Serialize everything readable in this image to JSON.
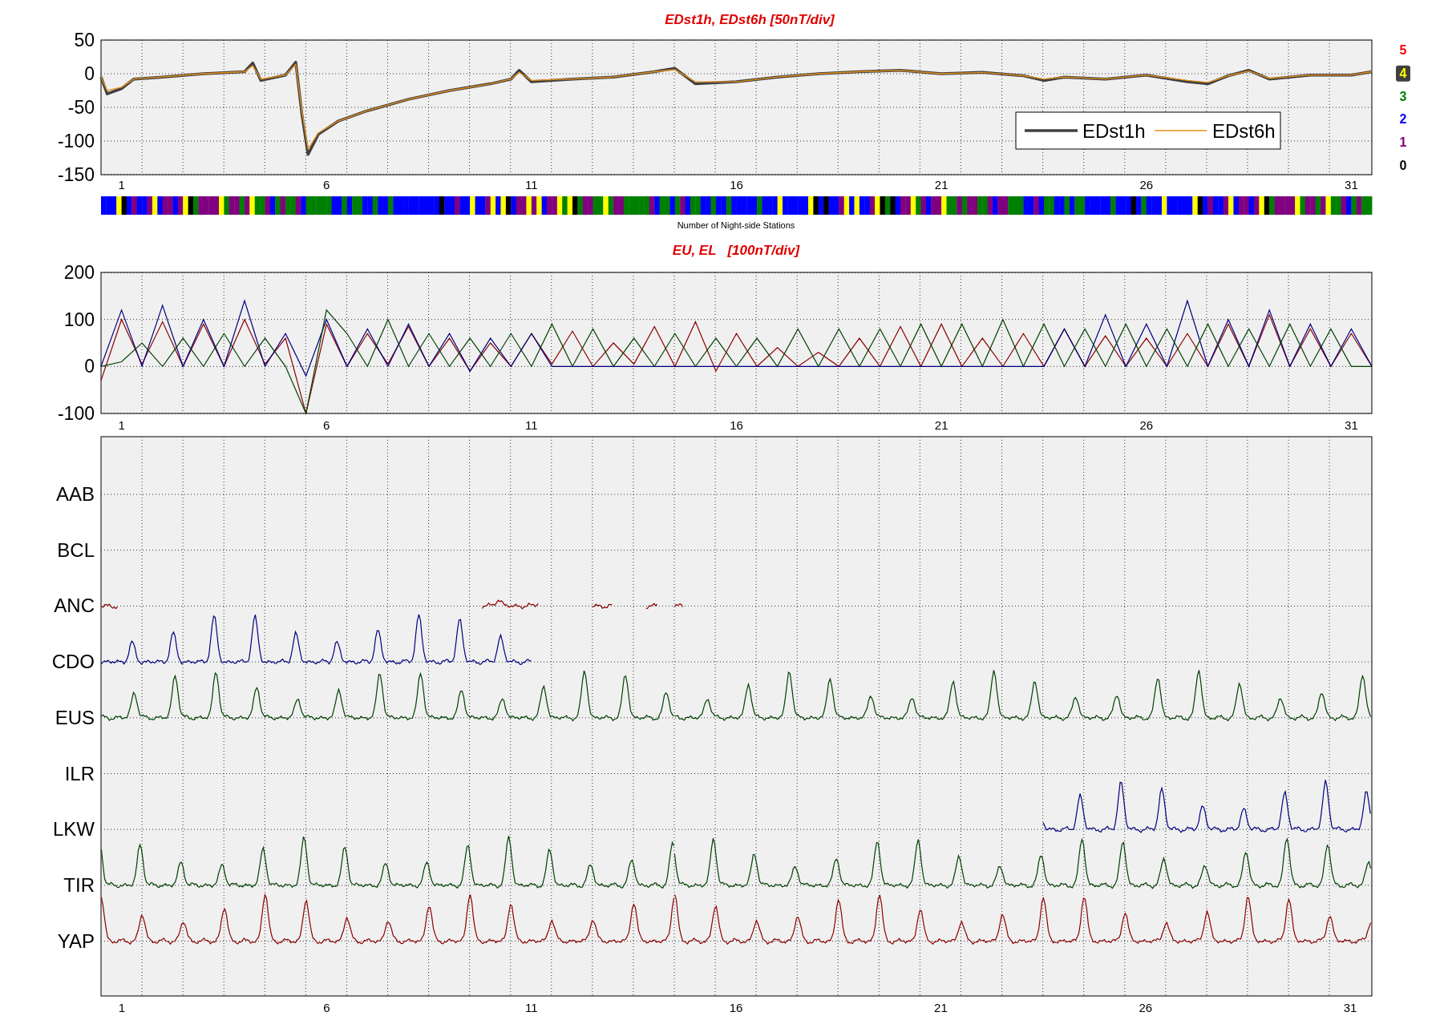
{
  "top_panel": {
    "chart_data": {
      "type": "line",
      "title": "EDst1h, EDst6h [50nT/div]",
      "x": [
        0.5,
        0.65,
        1,
        1.3,
        2,
        3,
        4,
        4.2,
        4.4,
        5,
        5.25,
        5.4,
        5.55,
        5.8,
        6.3,
        7,
        8,
        9,
        10,
        10.5,
        10.7,
        11,
        12,
        13,
        14,
        14.5,
        15,
        16,
        17,
        18,
        19,
        20,
        21,
        22,
        23,
        23.5,
        24,
        25,
        26,
        27,
        27.5,
        28,
        28.5,
        29,
        30,
        31,
        31.5
      ],
      "series": [
        {
          "name": "EDst1h",
          "color": "#404040",
          "values": [
            -5,
            -30,
            -22,
            -8,
            -5,
            0,
            3,
            16,
            -10,
            -2,
            17,
            -60,
            -120,
            -90,
            -70,
            -55,
            -38,
            -25,
            -15,
            -8,
            5,
            -12,
            -8,
            -5,
            3,
            8,
            -15,
            -12,
            -5,
            0,
            3,
            5,
            0,
            2,
            -3,
            -10,
            -5,
            -8,
            -2,
            -12,
            -15,
            -3,
            5,
            -8,
            -2,
            -2,
            3
          ]
        },
        {
          "name": "EDst6h",
          "color": "#e8901a",
          "values": [
            -5,
            -25,
            -20,
            -8,
            -5,
            0,
            3,
            12,
            -8,
            -2,
            14,
            -55,
            -112,
            -88,
            -70,
            -55,
            -38,
            -25,
            -15,
            -8,
            2,
            -10,
            -8,
            -5,
            3,
            6,
            -12,
            -12,
            -5,
            0,
            3,
            5,
            0,
            2,
            -3,
            -8,
            -5,
            -8,
            -2,
            -10,
            -13,
            -3,
            4,
            -7,
            -2,
            -2,
            3
          ]
        }
      ],
      "ylim": [
        -150,
        50
      ],
      "yticks": [
        50,
        0,
        -50,
        -100,
        -150
      ],
      "xlim": [
        0.5,
        31.5
      ],
      "xticks": [
        1,
        6,
        11,
        16,
        21,
        26,
        31
      ],
      "grid": true,
      "legend": "lower right"
    }
  },
  "station_bar": {
    "label": "Number of Night-side Stations",
    "levels": [
      {
        "label": "5",
        "color": "#ff0000"
      },
      {
        "label": "4",
        "color": "#ffff00"
      },
      {
        "label": "3",
        "color": "#008000"
      },
      {
        "label": "2",
        "color": "#0000ff"
      },
      {
        "label": "1",
        "color": "#800080"
      },
      {
        "label": "0",
        "color": "#000000"
      }
    ]
  },
  "eu_el_panel": {
    "chart_data": {
      "type": "line",
      "title": "EU, EL   [100nT/div]",
      "x": [
        0.5,
        1,
        1.5,
        2,
        2.5,
        3,
        3.5,
        4,
        4.5,
        5,
        5.5,
        6,
        6.5,
        7,
        7.5,
        8,
        8.5,
        9,
        9.5,
        10,
        10.5,
        11,
        11.5,
        12,
        12.5,
        13,
        13.5,
        14,
        14.5,
        15,
        15.5,
        16,
        16.5,
        17,
        17.5,
        18,
        18.5,
        19,
        19.5,
        20,
        20.5,
        21,
        21.5,
        22,
        22.5,
        23,
        23.5,
        24,
        24.5,
        25,
        25.5,
        26,
        26.5,
        27,
        27.5,
        28,
        28.5,
        29,
        29.5,
        30,
        30.5,
        31,
        31.5
      ],
      "series": [
        {
          "color": "#8b0000",
          "values": [
            -30,
            100,
            5,
            95,
            0,
            90,
            0,
            100,
            5,
            60,
            -100,
            90,
            0,
            70,
            5,
            85,
            0,
            60,
            -10,
            50,
            0,
            70,
            5,
            75,
            0,
            50,
            5,
            85,
            0,
            95,
            -10,
            70,
            0,
            40,
            0,
            30,
            0,
            60,
            0,
            85,
            0,
            90,
            0,
            60,
            0,
            70,
            0,
            80,
            0,
            65,
            0,
            60,
            0,
            70,
            0,
            90,
            0,
            110,
            0,
            80,
            0,
            70,
            0
          ]
        },
        {
          "color": "#000080",
          "values": [
            0,
            120,
            0,
            130,
            0,
            100,
            0,
            140,
            0,
            70,
            -20,
            100,
            0,
            80,
            0,
            90,
            0,
            70,
            -10,
            60,
            0,
            70,
            0,
            0,
            0,
            0,
            0,
            0,
            0,
            0,
            0,
            0,
            0,
            0,
            0,
            0,
            0,
            0,
            0,
            0,
            0,
            0,
            0,
            0,
            0,
            0,
            0,
            80,
            0,
            110,
            0,
            90,
            0,
            140,
            0,
            100,
            0,
            120,
            0,
            90,
            0,
            80,
            0
          ]
        },
        {
          "color": "#004000",
          "values": [
            0,
            10,
            50,
            0,
            60,
            0,
            70,
            0,
            60,
            0,
            -100,
            120,
            70,
            0,
            100,
            0,
            70,
            0,
            60,
            0,
            70,
            0,
            90,
            0,
            80,
            0,
            60,
            0,
            70,
            0,
            60,
            0,
            60,
            0,
            80,
            0,
            80,
            0,
            80,
            0,
            90,
            0,
            90,
            0,
            100,
            0,
            90,
            0,
            80,
            0,
            90,
            0,
            80,
            0,
            90,
            0,
            80,
            0,
            90,
            0,
            80,
            0,
            0
          ]
        }
      ],
      "ylim": [
        -100,
        200
      ],
      "yticks": [
        200,
        100,
        0,
        -100
      ],
      "xlim": [
        0.5,
        31.5
      ],
      "xticks": [
        1,
        6,
        11,
        16,
        21,
        26,
        31
      ],
      "grid": true
    }
  },
  "station_panel": {
    "xticks": [
      "1",
      "6",
      "11",
      "16",
      "21",
      "26",
      "31"
    ],
    "stations": [
      {
        "name": "AAB",
        "kind": "none"
      },
      {
        "name": "BCL",
        "kind": "none"
      },
      {
        "name": "ANC",
        "kind": "sparse",
        "color": "#8b0000"
      },
      {
        "name": "CDO",
        "kind": "early",
        "color": "#000080"
      },
      {
        "name": "EUS",
        "kind": "full",
        "color": "#004000"
      },
      {
        "name": "ILR",
        "kind": "none"
      },
      {
        "name": "LKW",
        "kind": "late",
        "color": "#000080"
      },
      {
        "name": "TIR",
        "kind": "full",
        "color": "#004000"
      },
      {
        "name": "YAP",
        "kind": "full",
        "color": "#8b0000"
      }
    ]
  }
}
